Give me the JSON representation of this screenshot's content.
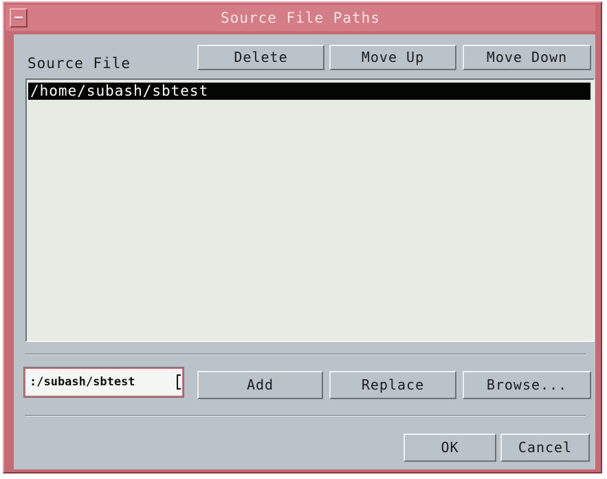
{
  "window": {
    "title": "Source File Paths"
  },
  "toolbar": {
    "source_file_label": "Source File",
    "delete_label": "Delete",
    "move_up_label": "Move Up",
    "move_down_label": "Move Down"
  },
  "list": {
    "items": [
      "/home/subash/sbtest"
    ],
    "selected_index": 0
  },
  "path_input": {
    "value": ":/subash/sbtest"
  },
  "actions": {
    "add_label": "Add",
    "replace_label": "Replace",
    "browse_label": "Browse..."
  },
  "footer": {
    "ok_label": "OK",
    "cancel_label": "Cancel"
  },
  "colors": {
    "window_frame": "#c76a74",
    "dialog_background": "#b9c3c9",
    "list_background": "#e6ebe4",
    "selection_background": "#050505"
  }
}
